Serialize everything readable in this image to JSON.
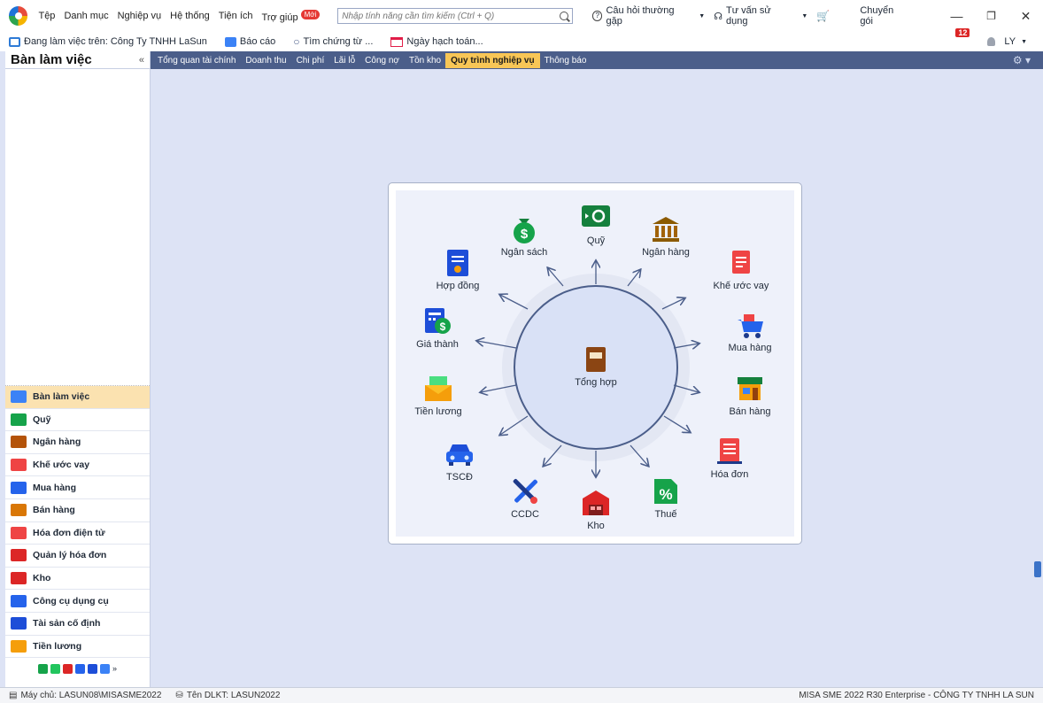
{
  "menubar": {
    "items": [
      "Tệp",
      "Danh mục",
      "Nghiệp vụ",
      "Hệ thống",
      "Tiện ích",
      "Trợ giúp"
    ],
    "new_badge": "Mới",
    "search_placeholder": "Nhập tính năng cần tìm kiếm (Ctrl + Q)",
    "faq": "Câu hỏi thường gặp",
    "support": "Tư vấn sử dụng",
    "switch_plan": "Chuyển gói",
    "notification_count": "12",
    "user": "LY"
  },
  "toolbar": {
    "working_on": "Đang làm việc trên: Công Ty TNHH LaSun",
    "report": "Báo cáo",
    "find_doc": "Tìm chứng từ ...",
    "posting_date": "Ngày hạch toán..."
  },
  "left_panel": {
    "title": "Bàn làm việc",
    "collapse": "«",
    "items": [
      {
        "label": "Bàn làm việc",
        "icon": "chart-icon",
        "color": "#3b82f6"
      },
      {
        "label": "Quỹ",
        "icon": "cash-icon",
        "color": "#16a34a"
      },
      {
        "label": "Ngân hàng",
        "icon": "bank-icon",
        "color": "#b45309"
      },
      {
        "label": "Khế ước vay",
        "icon": "loan-icon",
        "color": "#ef4444"
      },
      {
        "label": "Mua hàng",
        "icon": "cart-icon",
        "color": "#2563eb"
      },
      {
        "label": "Bán hàng",
        "icon": "store-icon",
        "color": "#d97706"
      },
      {
        "label": "Hóa đơn điện tử",
        "icon": "einvoice-icon",
        "color": "#ef4444"
      },
      {
        "label": "Quản lý hóa đơn",
        "icon": "invoice-icon",
        "color": "#dc2626"
      },
      {
        "label": "Kho",
        "icon": "warehouse-icon",
        "color": "#dc2626"
      },
      {
        "label": "Công cụ dụng cụ",
        "icon": "tools-icon",
        "color": "#2563eb"
      },
      {
        "label": "Tài sản cố định",
        "icon": "car-icon",
        "color": "#1d4ed8"
      },
      {
        "label": "Tiền lương",
        "icon": "salary-icon",
        "color": "#f59e0b"
      }
    ]
  },
  "tabs": [
    {
      "label": "Tổng quan tài chính",
      "active": false
    },
    {
      "label": "Doanh thu",
      "active": false
    },
    {
      "label": "Chi phí",
      "active": false
    },
    {
      "label": "Lãi lỗ",
      "active": false
    },
    {
      "label": "Công nợ",
      "active": false
    },
    {
      "label": "Tồn kho",
      "active": false
    },
    {
      "label": "Quy trình nghiệp vụ",
      "active": true
    },
    {
      "label": "Thông báo",
      "active": false
    }
  ],
  "process": {
    "center": "Tổng hợp",
    "nodes": {
      "quy": "Quỹ",
      "ngan_sach": "Ngân sách",
      "ngan_hang": "Ngân hàng",
      "hop_dong": "Hợp đồng",
      "khe_uoc_vay": "Khế ước vay",
      "gia_thanh": "Giá thành",
      "mua_hang": "Mua hàng",
      "tien_luong": "Tiền lương",
      "ban_hang": "Bán hàng",
      "tscd": "TSCĐ",
      "hoa_don": "Hóa đơn",
      "ccdc": "CCDC",
      "thue": "Thuế",
      "kho": "Kho"
    }
  },
  "statusbar": {
    "server": "Máy chủ: LASUN08\\MISASME2022",
    "db_name": "Tên DLKT: LASUN2022",
    "product": "MISA SME 2022 R30 Enterprise - CÔNG TY TNHH LA SUN"
  }
}
